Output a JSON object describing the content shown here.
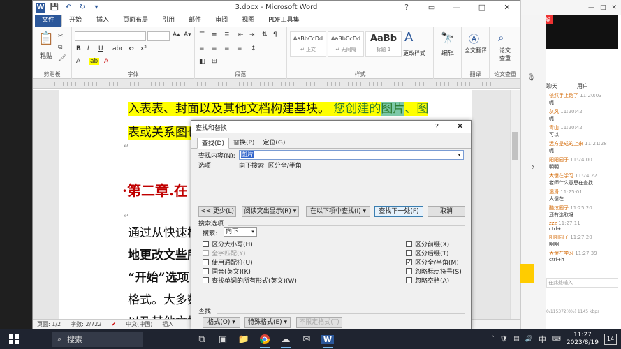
{
  "word": {
    "window_title": "3.docx - Microsoft Word",
    "tabs": [
      "文件",
      "开始",
      "插入",
      "页面布局",
      "引用",
      "邮件",
      "审阅",
      "视图",
      "PDF工具集"
    ],
    "active_tab": "开始",
    "ribbon": {
      "clipboard": {
        "paste": "粘贴",
        "label": "剪贴板"
      },
      "font": {
        "label": "字体",
        "bold": "B",
        "italic": "I",
        "underline": "U"
      },
      "paragraph": {
        "label": "段落"
      },
      "styles": {
        "label": "样式",
        "items": [
          {
            "preview": "AaBbCcDd",
            "name": "↵ 正文"
          },
          {
            "preview": "AaBbCcDd",
            "name": "↵ 无间隔"
          },
          {
            "preview": "AaBb",
            "name": "标题 1"
          }
        ],
        "change_styles": "更改样式"
      },
      "editing": {
        "label": "编辑"
      },
      "translate": {
        "full_text": "全文翻译",
        "label": "翻译"
      },
      "paper_check": {
        "label": "论文查重",
        "line1": "论文",
        "line2": "查重"
      }
    },
    "document": {
      "line1_a": "入表表、封面以及其他文档构建基块。",
      "line1_b": " 您创建的",
      "line1_sel": "图片",
      "line1_c": "、图",
      "line2": "表或关系图也",
      "heading": "·第二章.在",
      "p1": "通过从快速样",
      "p2": "地更改文些所",
      "p3": "“开始”选项",
      "p4": "格式。大多数",
      "p5": "以及其他文档"
    },
    "status": {
      "page": "页面: 1/2",
      "words": "字数: 2/722",
      "lang": "中文(中国)",
      "mode": "插入"
    }
  },
  "dialog": {
    "title": "查找和替换",
    "help": "?",
    "close": "✕",
    "tabs": [
      "查找(D)",
      "替换(P)",
      "定位(G)"
    ],
    "find_label": "查找内容(N):",
    "find_value": "图片",
    "options_label": "选项:",
    "options_value": "向下搜索, 区分全/半角",
    "buttons": {
      "less": "<< 更少(L)",
      "reading_highlight": "阅读突出显示(R) ▾",
      "find_in": "在以下项中查找(I) ▾",
      "find_next": "查找下一处(F)",
      "cancel": "取消"
    },
    "search_options_title": "搜索选项",
    "search_label": "搜索:",
    "search_value": "向下",
    "checks_left": [
      {
        "label": "区分大小写(H)",
        "checked": false,
        "disabled": false
      },
      {
        "label": "全字匹配(Y)",
        "checked": false,
        "disabled": true
      },
      {
        "label": "使用通配符(U)",
        "checked": false,
        "disabled": false
      },
      {
        "label": "同音(英文)(K)",
        "checked": false,
        "disabled": false
      },
      {
        "label": "查找单词的所有形式(英文)(W)",
        "checked": false,
        "disabled": false
      }
    ],
    "checks_right": [
      {
        "label": "区分前缀(X)",
        "checked": false
      },
      {
        "label": "区分后缀(T)",
        "checked": false
      },
      {
        "label": "区分全/半角(M)",
        "checked": true
      },
      {
        "label": "忽略标点符号(S)",
        "checked": false
      },
      {
        "label": "忽略空格(A)",
        "checked": false
      }
    ],
    "find_section": "查找",
    "format_btn": "格式(O) ▾",
    "special_btn": "特殊格式(E) ▾",
    "no_format_btn": "不限定格式(T)"
  },
  "right_app": {
    "top_label": "上课提醒",
    "tabs": [
      "聊天",
      "用户"
    ],
    "messages": [
      {
        "user": "依然手上路了",
        "time": "11:20:03",
        "text": "呢"
      },
      {
        "user": "灰风",
        "time": "11:20:42",
        "text": "呢"
      },
      {
        "user": "青山",
        "time": "11:20:42",
        "text": "可以"
      },
      {
        "user": "远方是成的上来",
        "time": "11:21:28",
        "text": "呢"
      },
      {
        "user": "阳阳园子",
        "time": "11:24:00",
        "text": "明明"
      },
      {
        "user": "大傻在学习",
        "time": "11:24:22",
        "text": "老师什么意思在查找"
      },
      {
        "user": "湿滑",
        "time": "11:25:01",
        "text": "大傻在"
      },
      {
        "user": "酷炫园子",
        "time": "11:25:20",
        "text": "还有选取呀"
      },
      {
        "user": "zzz",
        "time": "11:27:11",
        "text": "ctrl+"
      },
      {
        "user": "阳阳园子",
        "time": "11:27:20",
        "text": "明明"
      },
      {
        "user": "大傻在学习",
        "time": "11:27:39",
        "text": "ctrl+h"
      }
    ],
    "input_placeholder": "在此处输入",
    "footer": "0/115372(0%) 1145 kbps"
  },
  "taskbar": {
    "search_placeholder": "搜索",
    "time": "11:27",
    "date": "2023/8/19",
    "ime": "中",
    "notifications": "14"
  }
}
